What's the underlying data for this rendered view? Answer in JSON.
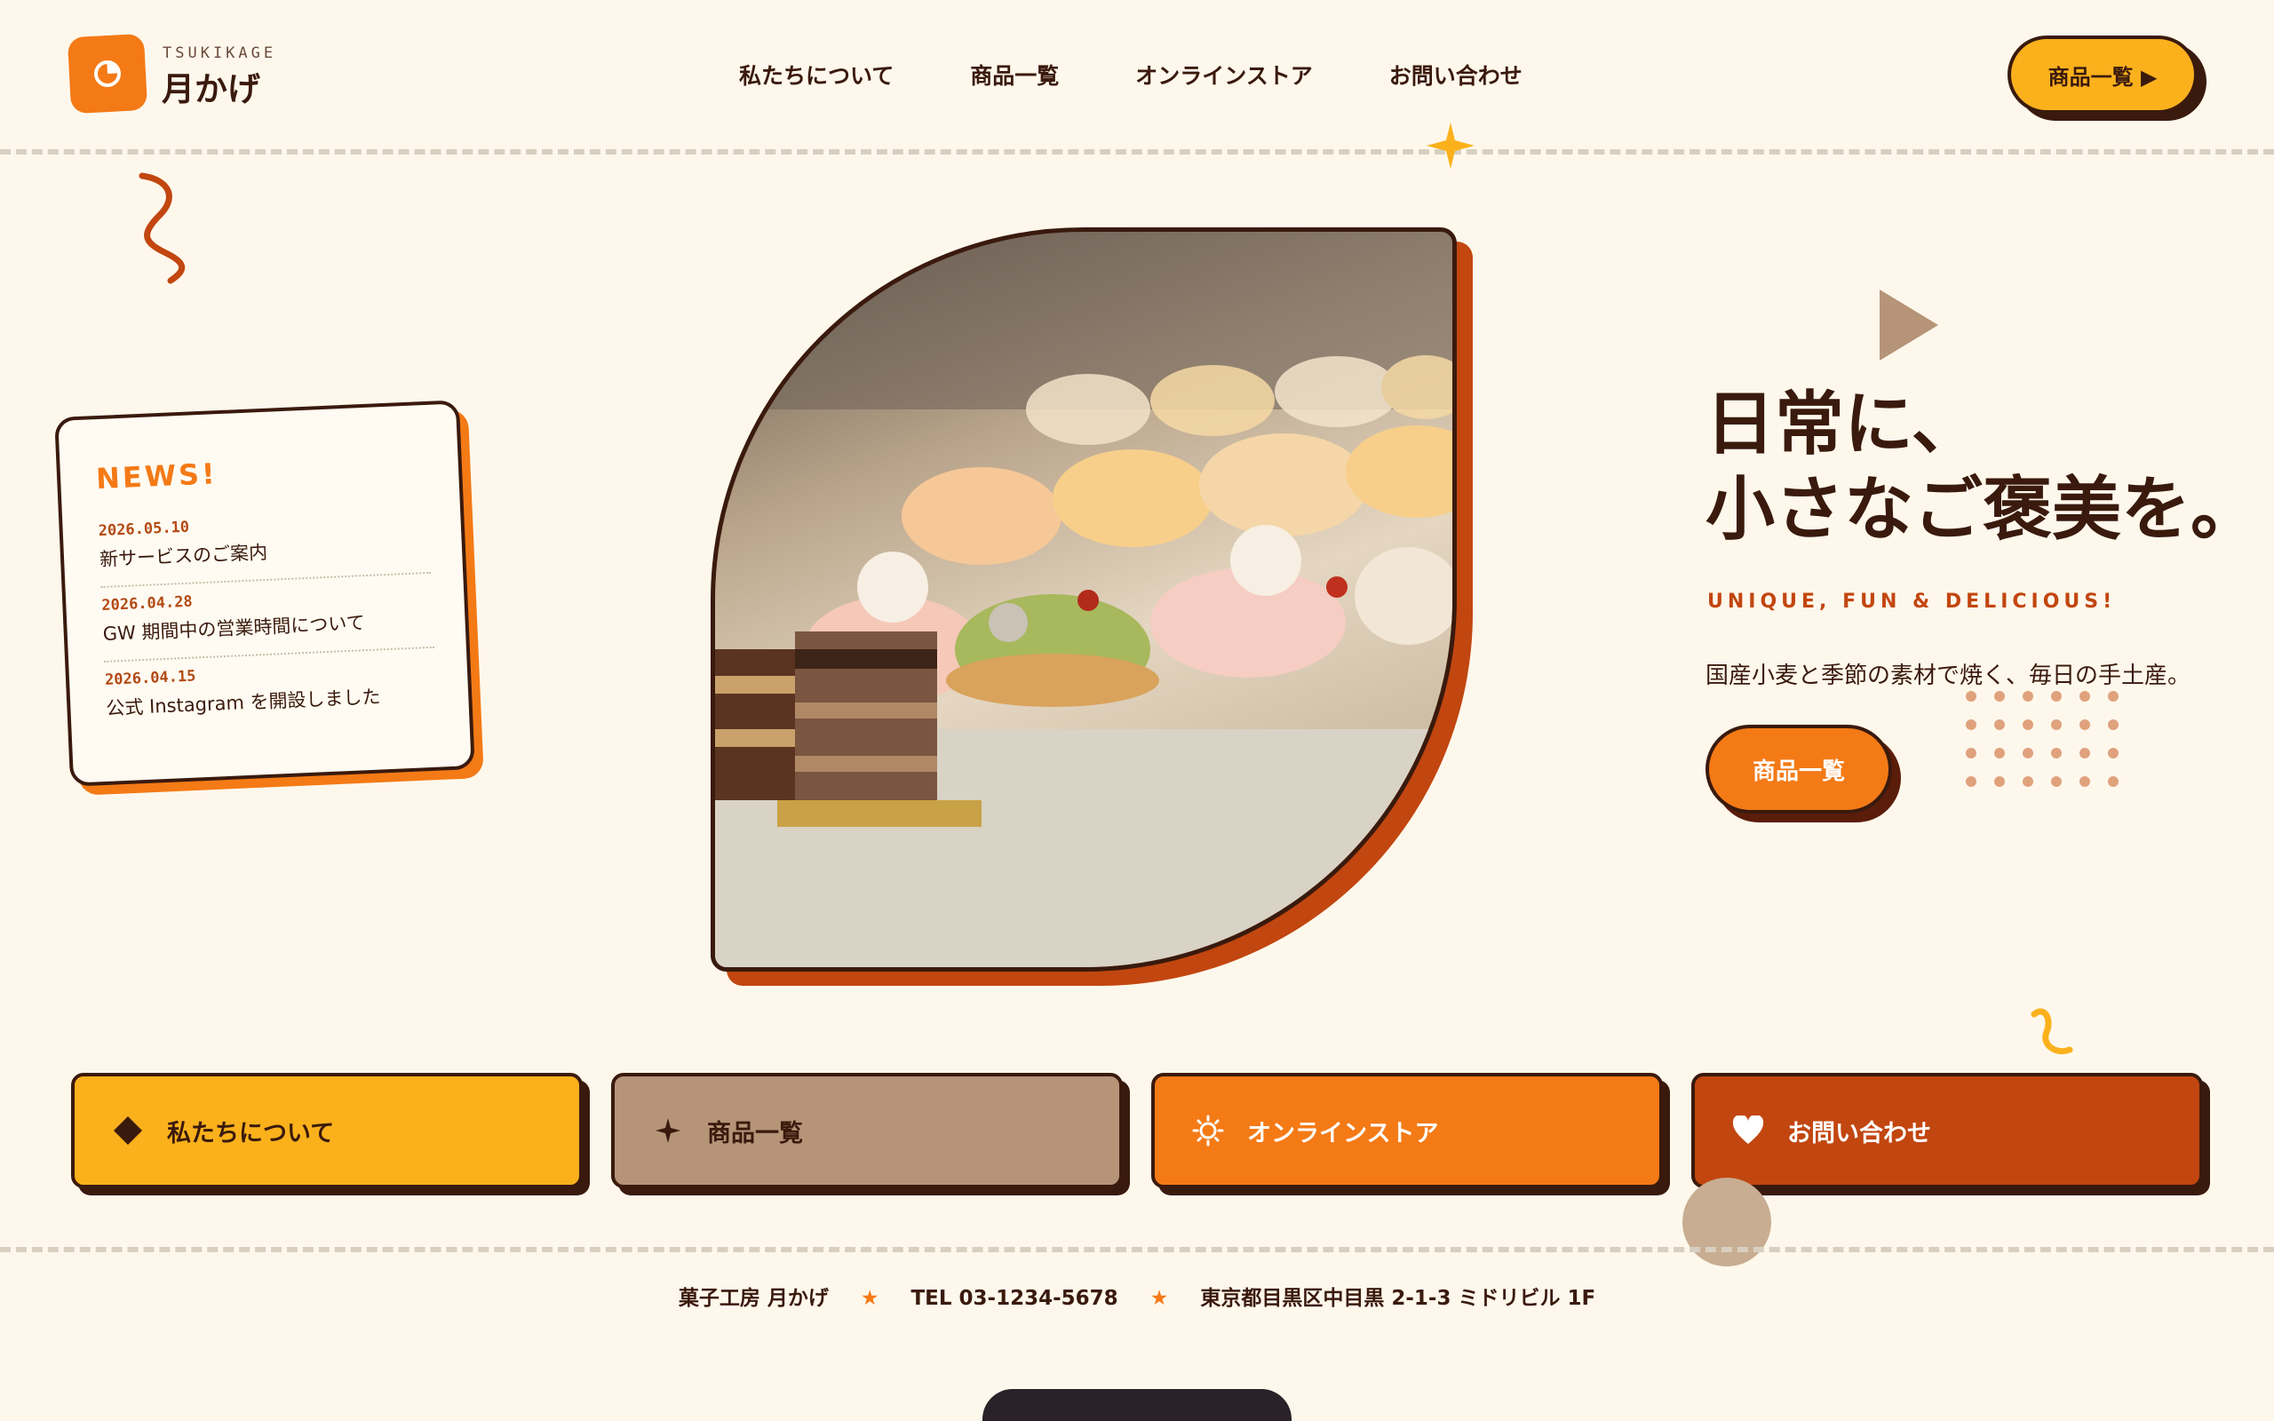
{
  "brand": {
    "name_en": "TSUKIKAGE",
    "name_jp": "月かげ",
    "logo_icon": "moon-clock-icon"
  },
  "nav": {
    "items": [
      "私たちについて",
      "商品一覧",
      "オンラインストア",
      "お問い合わせ"
    ],
    "cta_label": "商品一覧 ▶"
  },
  "news": {
    "title": "NEWS!",
    "items": [
      {
        "date": "2026.05.10",
        "text": "新サービスのご案内"
      },
      {
        "date": "2026.04.28",
        "text": "GW 期間中の営業時間について"
      },
      {
        "date": "2026.04.15",
        "text": "公式 Instagram を開設しました"
      }
    ]
  },
  "hero": {
    "headline_line1": "日常に、",
    "headline_line2": "小さなご褒美を。",
    "tagline": "UNIQUE, FUN & DELICIOUS!",
    "description": "国産小麦と季節の素材で焼く、毎日の手土産。",
    "button_label": "商品一覧"
  },
  "categories": [
    {
      "label": "私たちについて",
      "icon": "diamond-icon",
      "bg": "#fbb11c",
      "fg": "#3a1a0d"
    },
    {
      "label": "商品一覧",
      "icon": "sparkle-icon",
      "bg": "#b69478",
      "fg": "#3a1a0d"
    },
    {
      "label": "オンラインストア",
      "icon": "sun-icon",
      "bg": "#f47a16",
      "fg": "#ffffff"
    },
    {
      "label": "お問い合わせ",
      "icon": "heart-icon",
      "bg": "#c2460f",
      "fg": "#ffffff"
    }
  ],
  "footer": {
    "shop": "菓子工房 月かげ",
    "tel": "TEL 03-1234-5678",
    "address": "東京都目黒区中目黒 2-1-3 ミドリビル 1F",
    "separator": "★"
  },
  "colors": {
    "bg": "#fef8ec",
    "brown": "#3a1a0d",
    "orange": "#f47a16",
    "yellow": "#fbb11c",
    "rust": "#c2460f",
    "taupe": "#b69478"
  }
}
